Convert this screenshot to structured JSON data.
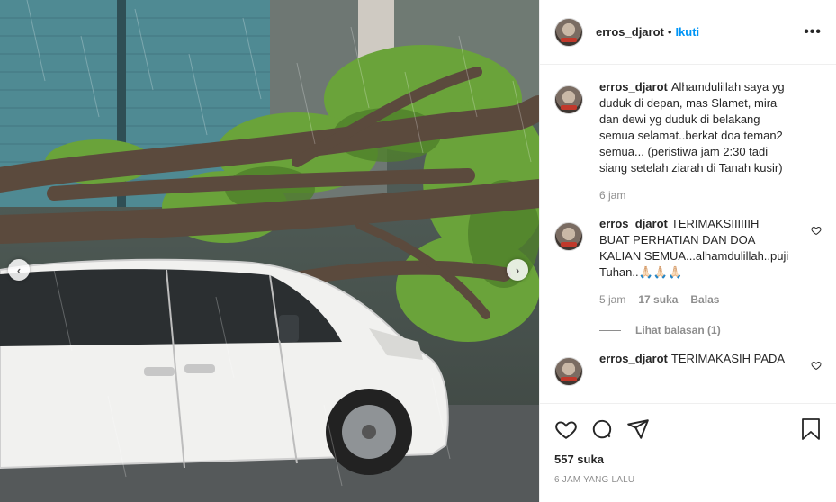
{
  "header": {
    "username": "erros_djarot",
    "separator": "•",
    "follow_label": "Ikuti",
    "more_label": "•••"
  },
  "photo": {
    "description_alt": "",
    "prev_label": "‹",
    "next_label": "›"
  },
  "comments": [
    {
      "user": "erros_djarot",
      "text": "Alhamdulillah saya yg duduk di depan, mas Slamet, mira dan dewi yg duduk di belakang semua selamat..berkat doa teman2 semua... (peristiwa jam 2:30 tadi siang setelah ziarah di Tanah kusir)",
      "time": "6 jam"
    },
    {
      "user": "erros_djarot",
      "text": "TERIMAKSIIIIIIH BUAT PERHATIAN DAN DOA KALIAN SEMUA...alhamdulillah..puji Tuhan..🙏🏻🙏🏻🙏🏻",
      "time": "5 jam",
      "likes": "17 suka",
      "reply": "Balas",
      "view_replies": "Lihat balasan (1)"
    },
    {
      "user": "erros_djarot",
      "text": "TERIMAKASIH PADA"
    }
  ],
  "actions": {
    "likes": "557 suka",
    "timestamp": "6 JAM YANG LALU"
  },
  "colors": {
    "accent": "#0095f6",
    "text": "#262626",
    "muted": "#8e8e8e",
    "border": "#efefef"
  }
}
